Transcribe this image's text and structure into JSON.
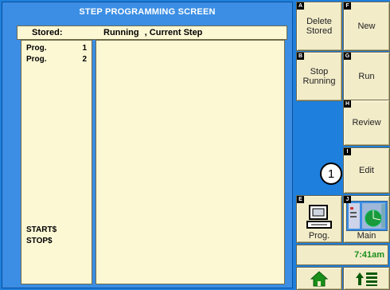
{
  "screen": {
    "title": "STEP PROGRAMMING SCREEN",
    "header": {
      "stored": "Stored:",
      "running": "Running",
      "current_step": ", Current Step"
    },
    "stored_programs": [
      {
        "label": "Prog.",
        "number": "1"
      },
      {
        "label": "Prog.",
        "number": "2"
      }
    ],
    "start_label": "START$",
    "stop_label": "STOP$"
  },
  "buttons": {
    "delete_stored": {
      "key": "A",
      "label_line1": "Delete",
      "label_line2": "Stored"
    },
    "new": {
      "key": "F",
      "label": "New"
    },
    "stop_running": {
      "key": "B",
      "label_line1": "Stop",
      "label_line2": "Running"
    },
    "run": {
      "key": "G",
      "label": "Run"
    },
    "review": {
      "key": "H",
      "label": "Review"
    },
    "edit": {
      "key": "I",
      "label": "Edit"
    },
    "prog": {
      "key": "E",
      "label": "Prog."
    },
    "main": {
      "key": "J",
      "label": "Main"
    }
  },
  "callout_number": "1",
  "clock": "7:41am",
  "nav": {
    "home_icon": "home-icon",
    "up_list_icon": "up-arrow-list-icon"
  }
}
